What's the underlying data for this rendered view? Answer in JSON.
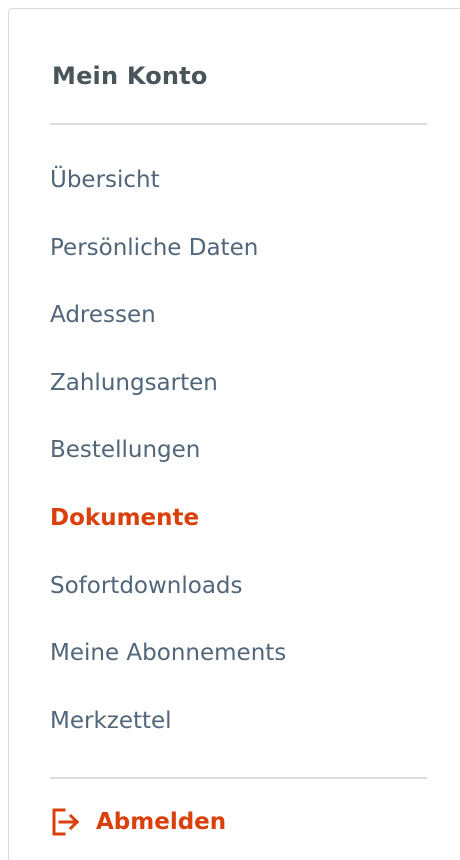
{
  "account_nav": {
    "title": "Mein Konto",
    "items": [
      {
        "label": "Übersicht",
        "active": false
      },
      {
        "label": "Persönliche Daten",
        "active": false
      },
      {
        "label": "Adressen",
        "active": false
      },
      {
        "label": "Zahlungsarten",
        "active": false
      },
      {
        "label": "Bestellungen",
        "active": false
      },
      {
        "label": "Dokumente",
        "active": true
      },
      {
        "label": "Sofortdownloads",
        "active": false
      },
      {
        "label": "Meine Abonnements",
        "active": false
      },
      {
        "label": "Merkzettel",
        "active": false
      }
    ],
    "logout": {
      "label": "Abmelden",
      "icon": "logout-icon"
    }
  },
  "colors": {
    "accent": "#d9400b",
    "text": "#52667a",
    "heading": "#4a545b",
    "border": "#dadae5"
  }
}
